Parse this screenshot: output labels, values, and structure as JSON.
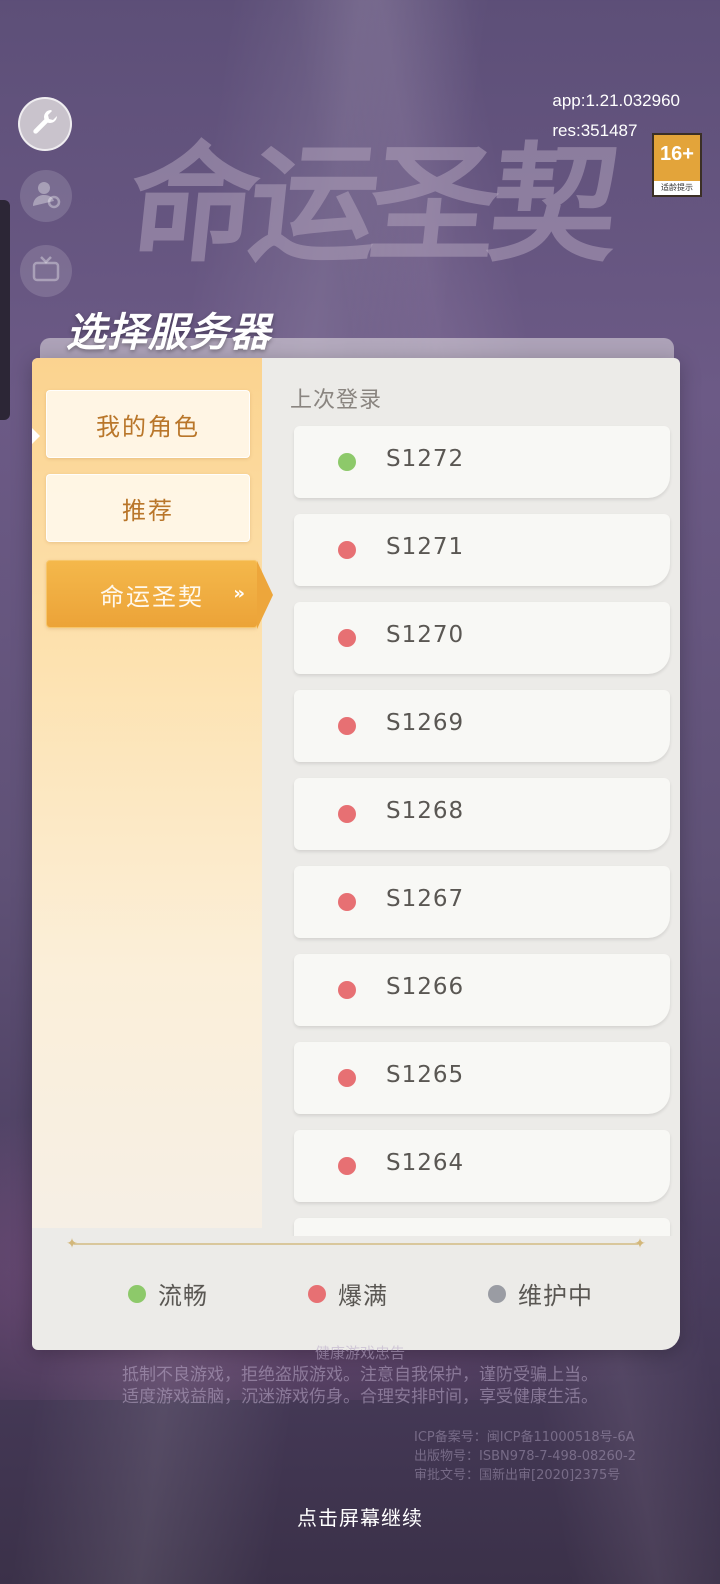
{
  "app": {
    "version_app": "app:1.21.032960",
    "version_res": "res:351487",
    "logo_text": "命运圣契",
    "age_rating": "16+",
    "age_rating_sub": "适龄提示"
  },
  "panel": {
    "title": "选择服务器",
    "tabs": [
      {
        "label": "我的角色"
      },
      {
        "label": "推荐"
      },
      {
        "label": "命运圣契"
      }
    ],
    "section_label": "上次登录",
    "servers": [
      {
        "name": "S1272",
        "status": "smooth"
      },
      {
        "name": "S1271",
        "status": "full"
      },
      {
        "name": "S1270",
        "status": "full"
      },
      {
        "name": "S1269",
        "status": "full"
      },
      {
        "name": "S1268",
        "status": "full"
      },
      {
        "name": "S1267",
        "status": "full"
      },
      {
        "name": "S1266",
        "status": "full"
      },
      {
        "name": "S1265",
        "status": "full"
      },
      {
        "name": "S1264",
        "status": "full"
      },
      {
        "name": "",
        "status": "full"
      }
    ],
    "legend": [
      {
        "label": "流畅",
        "color": "#8dc96a"
      },
      {
        "label": "爆满",
        "color": "#e77073"
      },
      {
        "label": "维护中",
        "color": "#9a9ca3"
      }
    ]
  },
  "status_colors": {
    "smooth": "#8dc96a",
    "full": "#e77073",
    "maintenance": "#9a9ca3"
  },
  "notice": {
    "title": "健康游戏忠告",
    "line1": "抵制不良游戏，拒绝盗版游戏。注意自我保护，谨防受骗上当。",
    "line2": "适度游戏益脑，沉迷游戏伤身。合理安排时间，享受健康生活。",
    "icp_1": "ICP备案号：闽ICP备11000518号-6A",
    "icp_2": "出版物号：ISBN978-7-498-08260-2",
    "icp_3": "审批文号：国新出审[2020]2375号"
  },
  "continue_text": "点击屏幕继续"
}
